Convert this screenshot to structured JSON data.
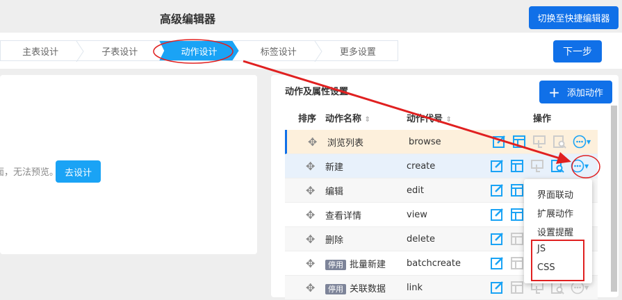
{
  "header": {
    "title": "高级编辑器",
    "switch_button": "切换至快捷编辑器"
  },
  "steps": [
    "主表设计",
    "子表设计",
    "动作设计",
    "标签设计",
    "更多设置"
  ],
  "active_step": 2,
  "next_button": "下一步",
  "left_panel": {
    "message": "面，无法预览。",
    "design_button": "去设计"
  },
  "right_panel": {
    "title": "动作及属性设置",
    "add_button": "添加动作",
    "columns": [
      "排序",
      "动作名称",
      "动作代号",
      "操作"
    ],
    "rows": [
      {
        "name": "浏览列表",
        "code": "browse",
        "tag": null
      },
      {
        "name": "新建",
        "code": "create",
        "tag": null
      },
      {
        "name": "编辑",
        "code": "edit",
        "tag": null
      },
      {
        "name": "查看详情",
        "code": "view",
        "tag": null
      },
      {
        "name": "删除",
        "code": "delete",
        "tag": null
      },
      {
        "name": "批量新建",
        "code": "batchcreate",
        "tag": "停用"
      },
      {
        "name": "关联数据",
        "code": "link",
        "tag": "停用"
      }
    ]
  },
  "dropdown": [
    "界面联动",
    "扩展动作",
    "设置提醒",
    "JS",
    "CSS"
  ],
  "colors": {
    "primary": "#1070e8",
    "active_step": "#1aa3f5",
    "annotation": "#e02020",
    "selected_row": "#fdf0dc",
    "hover_row": "#e8f1fb"
  }
}
